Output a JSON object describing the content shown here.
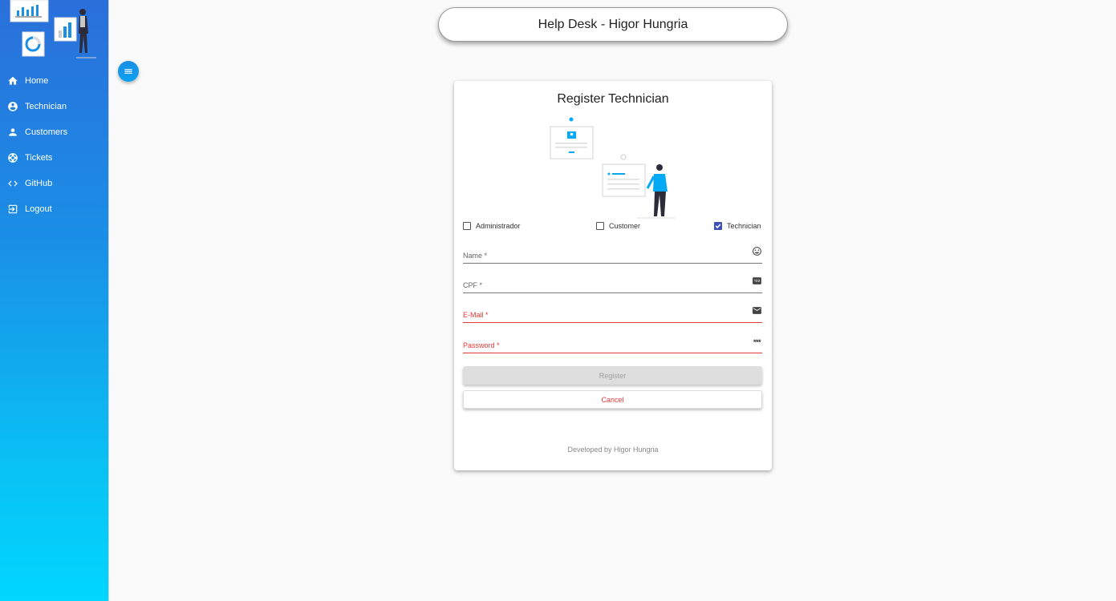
{
  "header": {
    "title": "Help Desk - Higor Hungria"
  },
  "sidebar": {
    "items": [
      {
        "label": "Home",
        "icon": "home-icon"
      },
      {
        "label": "Technician",
        "icon": "account-circle-icon"
      },
      {
        "label": "Customers",
        "icon": "person-icon"
      },
      {
        "label": "Tickets",
        "icon": "support-icon"
      },
      {
        "label": "GitHub",
        "icon": "code-icon"
      },
      {
        "label": "Logout",
        "icon": "logout-icon"
      }
    ]
  },
  "form": {
    "title": "Register Technician",
    "profiles": [
      {
        "label": "Administrador",
        "checked": false
      },
      {
        "label": "Customer",
        "checked": false
      },
      {
        "label": "Technician",
        "checked": true
      }
    ],
    "fields": {
      "name": {
        "label": "Name *",
        "icon": "mood-icon"
      },
      "cpf": {
        "label": "CPF *",
        "icon": "pin-icon"
      },
      "email": {
        "label": "E-Mail *",
        "icon": "mail-icon"
      },
      "password": {
        "label": "Password *",
        "icon": "password-icon",
        "icon_text": "***"
      }
    },
    "register_label": "Register",
    "cancel_label": "Cancel",
    "footer": "Developed by Higor Hungria"
  },
  "colors": {
    "accent": "#3f51b5",
    "error": "#e53935",
    "sidebar_top": "#2a6fdb",
    "sidebar_bottom": "#00d6ff",
    "illustration": "#03a9f4"
  }
}
